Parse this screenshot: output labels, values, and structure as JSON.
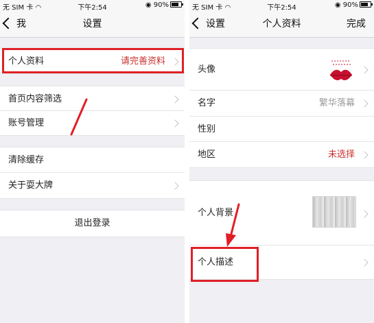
{
  "left": {
    "status": {
      "carrier": "无 SIM 卡",
      "time": "下午2:54",
      "battery": "90%"
    },
    "nav": {
      "back_label": "我",
      "title": "设置"
    },
    "rows": [
      {
        "label": "个人资料",
        "value": "请完善资料"
      },
      {
        "label": "首页内容筛选"
      },
      {
        "label": "账号管理"
      },
      {
        "label": "清除缓存"
      },
      {
        "label": "关于耍大牌"
      }
    ],
    "logout_label": "退出登录"
  },
  "right": {
    "status": {
      "carrier": "无 SIM 卡",
      "time": "下午2:54",
      "battery": "90%"
    },
    "nav": {
      "back_label": "设置",
      "title": "个人资料",
      "done_label": "完成"
    },
    "rows": [
      {
        "label": "头像"
      },
      {
        "label": "名字",
        "value": "繁华落幕"
      },
      {
        "label": "性别"
      },
      {
        "label": "地区",
        "value": "未选择"
      },
      {
        "label": "个人背景"
      },
      {
        "label": "个人描述"
      }
    ]
  },
  "colors": {
    "accent_red": "#c9302c",
    "highlight": "#e01f26",
    "background": "#efeff4"
  }
}
